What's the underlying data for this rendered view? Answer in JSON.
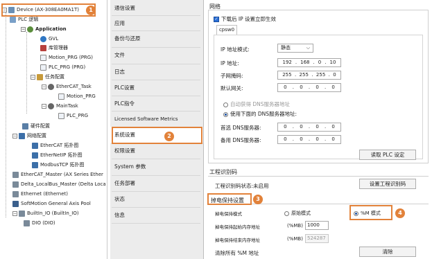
{
  "tree": {
    "device": "Device (AX-308EA0MA1T)",
    "plc_logic": "PLC 逻辑",
    "application": "Application",
    "gvl": "GVL",
    "library_manager": "库管理器",
    "motion_prg": "Motion_PRG (PRG)",
    "plc_prg": "PLC_PRG (PRG)",
    "task_config": "任务配置",
    "ethercat_task": "EtherCAT_Task",
    "motion_prg_call": "Motion_PRG",
    "main_task": "MainTask",
    "plc_prg_call": "PLC_PRG",
    "hw_config": "硬件配置",
    "net_config": "网络配置",
    "ethercat_topo": "EtherCAT 拓扑图",
    "ethernetip_topo": "EtherNetIP 拓扑图",
    "modbustcp_topo": "ModbusTCP 拓扑图",
    "ethercat_master": "EtherCAT_Master (AX Series Ether",
    "delta_localbus": "Delta_LocalBus_Master (Delta Loca",
    "ethernet": "Ethernet (Ethernet)",
    "softmotion_pool": "SoftMotion General Axis Pool",
    "builtin_io": "BuiltIn_IO (BuiltIn_IO)",
    "dio": "DIO (DIO)"
  },
  "menu": {
    "items": [
      "通信设置",
      "应用",
      "备份与还原",
      "文件",
      "日志",
      "PLC设置",
      "PLC指令",
      "Licensed Software Metrics",
      "系统设置",
      "权限设置",
      "System 参数",
      "任务部署",
      "状态",
      "信息"
    ]
  },
  "network": {
    "title": "网络",
    "apply_after_download": "下载后 IP 设置立即生效",
    "tab": "cpsw0",
    "ip_mode_label": "IP 地址模式:",
    "ip_mode_value": "静态",
    "ip_label": "IP 地址:",
    "ip": [
      "192",
      "168",
      "0",
      "10"
    ],
    "mask_label": "子网掩码:",
    "mask": [
      "255",
      "255",
      "255",
      "0"
    ],
    "gateway_label": "默认网关:",
    "gateway": [
      "0",
      "0",
      "0",
      "0"
    ],
    "dns_auto": "自动获得 DNS服务器地址",
    "dns_manual": "使用下面的 DNS服务器地址:",
    "dns1_label": "首选 DNS服务器:",
    "dns1": [
      "0",
      "0",
      "0",
      "0"
    ],
    "dns2_label": "备用 DNS服务器:",
    "dns2": [
      "0",
      "0",
      "0",
      "0"
    ],
    "read_plc_button": "读取 PLC 设定"
  },
  "project_id": {
    "title": "工程识别码",
    "status": "工程识别码状态:未启用",
    "set_button": "设置工程识别码"
  },
  "retain": {
    "title": "掉电保持设置",
    "mode_label": "掉电保持模式",
    "origin_mode": "原始模式",
    "m_mode": "%M 模式",
    "start_label": "掉电保持起始内存地址",
    "start_unit": "(%MB)",
    "start_value": "1000",
    "end_label": "掉电保持结束内存地址",
    "end_unit": "(%MB)",
    "end_value": "524287",
    "clear_label": "清除所有 %M 地址",
    "clear_button": "清除"
  },
  "badges": [
    "1",
    "2",
    "3",
    "4"
  ],
  "colors": {
    "accent": "#e2823a",
    "selected_menu": "#ffffff"
  }
}
